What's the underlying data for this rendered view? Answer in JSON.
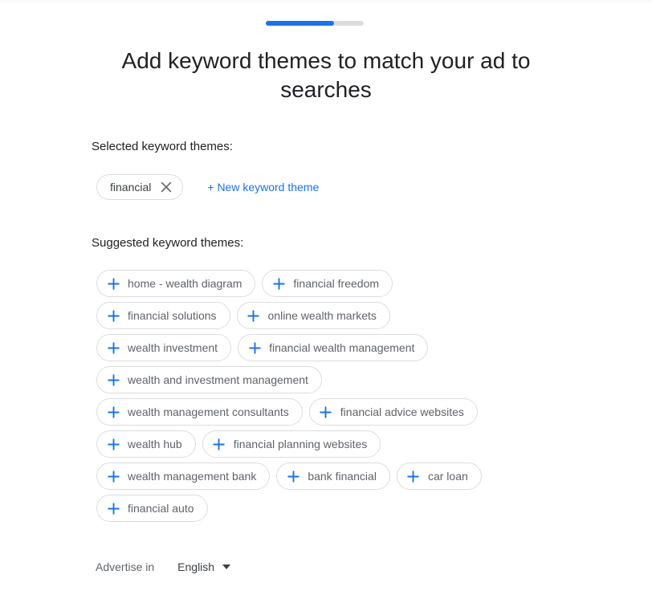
{
  "progress": {
    "percent": 70,
    "fill_color": "#1a73e8",
    "track_color": "#dadce0"
  },
  "header": {
    "title": "Add keyword themes to match your ad to searches"
  },
  "selected_section": {
    "label": "Selected keyword themes:",
    "chips": [
      {
        "label": "financial",
        "close_icon": "close-icon"
      }
    ],
    "new_theme_label": "+ New keyword theme",
    "link_color": "#1a73e8"
  },
  "suggested_section": {
    "label": "Suggested keyword themes:",
    "add_icon": "plus-icon",
    "chips": [
      {
        "label": "home - wealth diagram"
      },
      {
        "label": "financial freedom"
      },
      {
        "label": "financial solutions"
      },
      {
        "label": "online wealth markets"
      },
      {
        "label": "wealth investment"
      },
      {
        "label": "financial wealth management"
      },
      {
        "label": "wealth and investment management"
      },
      {
        "label": "wealth management consultants"
      },
      {
        "label": "financial advice websites"
      },
      {
        "label": "wealth hub"
      },
      {
        "label": "financial planning websites"
      },
      {
        "label": "wealth management bank"
      },
      {
        "label": "bank financial"
      },
      {
        "label": "car loan"
      },
      {
        "label": "financial auto"
      }
    ]
  },
  "footer": {
    "advertise_label": "Advertise in",
    "language_value": "English",
    "caret_icon": "chevron-down-icon"
  },
  "theme": {
    "accent": "#1a73e8",
    "text_primary": "#202124",
    "text_secondary": "#5f6368",
    "chip_border": "#dadce0",
    "background": "#ffffff"
  }
}
